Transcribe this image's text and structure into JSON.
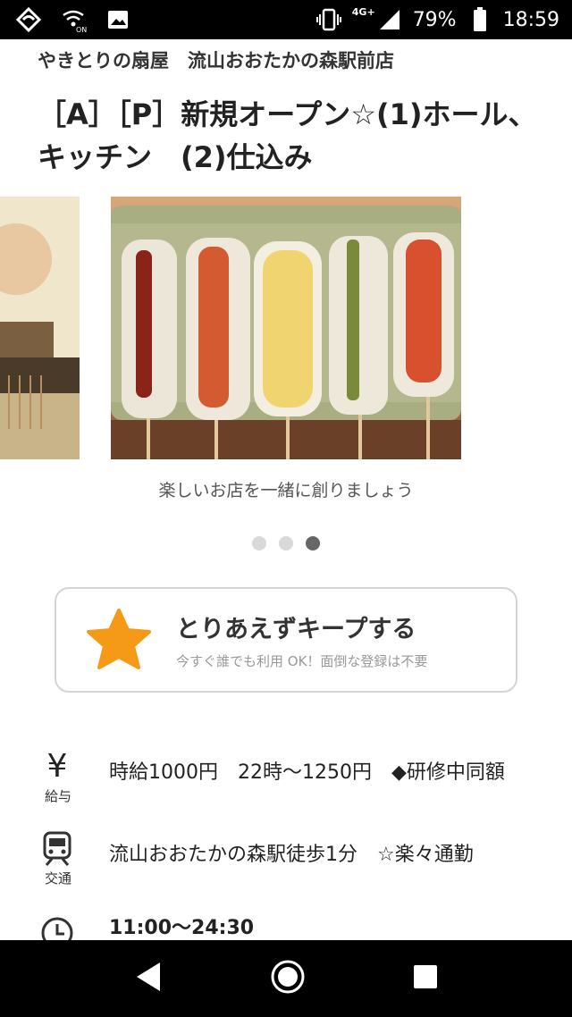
{
  "status_bar": {
    "network": "4G+",
    "battery": "79%",
    "time": "18:59"
  },
  "job": {
    "shop_name": "やきとりの扇屋　流山おおたかの森駅前店",
    "title": "［A］［P］新規オープン☆(1)ホール、キッチン　(2)仕込み"
  },
  "carousel": {
    "caption": "楽しいお店を一緒に創りましょう",
    "dots": 3,
    "active_index": 2
  },
  "keep": {
    "label": "とりあえずキープする",
    "sub": "今すぐ誰でも利用 OK！面倒な登録は不要"
  },
  "info": {
    "salary_icon": "¥",
    "salary_label": "給与",
    "salary_text": "時給1000円　22時〜1250円　◆研修中同額",
    "transport_label": "交通",
    "transport_text": "流山おおたかの森駅徒歩1分　☆楽々通勤",
    "hours_text": "11:00〜24:30"
  },
  "colors": {
    "star": "#f59a17",
    "dot_active": "#666666",
    "dot_inactive": "#d9d9d9"
  }
}
